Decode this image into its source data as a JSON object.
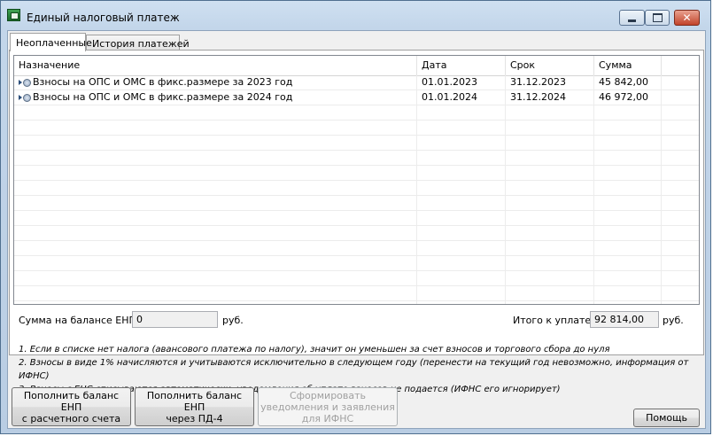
{
  "window": {
    "title": "Единый налоговый платеж",
    "controls": {
      "minimize": "—",
      "maximize": "",
      "close": "✕"
    }
  },
  "tabs": [
    {
      "label": "Неоплаченные",
      "active": true
    },
    {
      "label": "История платежей",
      "active": false
    }
  ],
  "table": {
    "columns": [
      "Назначение",
      "Дата",
      "Срок",
      "Сумма"
    ],
    "rows": [
      {
        "name": "Взносы на ОПС и ОМС в фикс.размере за 2023 год",
        "date": "01.01.2023",
        "due": "31.12.2023",
        "sum": "45 842,00"
      },
      {
        "name": "Взносы на ОПС и ОМС в фикс.размере за 2024 год",
        "date": "01.01.2024",
        "due": "31.12.2024",
        "sum": "46 972,00"
      }
    ]
  },
  "balance": {
    "label": "Сумма на балансе ЕНП:",
    "value": "0",
    "unit": "руб."
  },
  "total": {
    "label": "Итого к уплате:",
    "value": "92 814,00",
    "unit": "руб."
  },
  "notes": [
    "1. Если в списке нет налога  (авансового платежа по налогу), значит он уменьшен за счет взносов и торгового сбора до нуля",
    "2. Взносы в виде 1% начисляются и учитываются исключительно в следующем году (перенести на текущий год невозможно, информация от ИФНС)",
    "3. Взносы с ЕНС списываются автоматически, уведомления об уплате взносов не подается (ИФНС его игнорирует)"
  ],
  "buttons": {
    "topup_account_l1": "Пополнить баланс ЕНП",
    "topup_account_l2": "с расчетного счета",
    "topup_pd4_l1": "Пополнить баланс ЕНП",
    "topup_pd4_l2": "через ПД-4",
    "form_notices_l1": "Сформировать",
    "form_notices_l2": "уведомления и заявления",
    "form_notices_l3": "для ИФНС",
    "help": "Помощь"
  }
}
